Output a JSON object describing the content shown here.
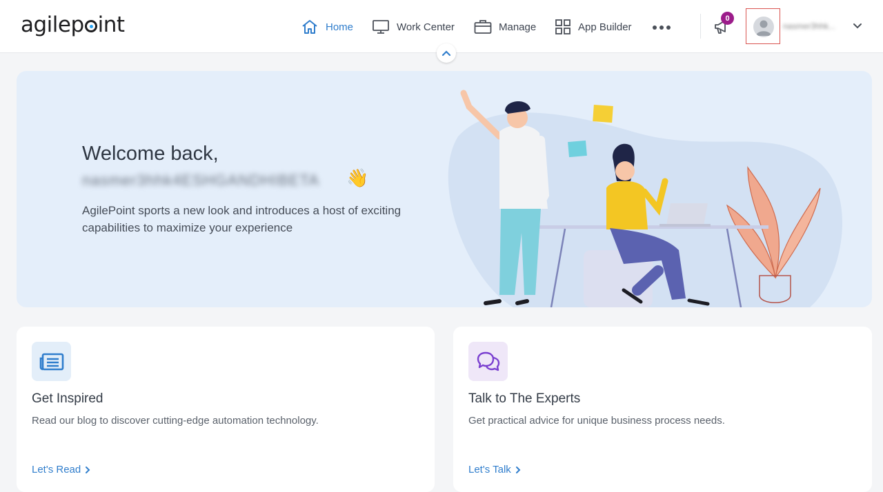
{
  "header": {
    "logo_text": "agilepoint",
    "nav": [
      {
        "label": "Home",
        "icon": "home-icon",
        "active": true
      },
      {
        "label": "Work Center",
        "icon": "monitor-icon"
      },
      {
        "label": "Manage",
        "icon": "briefcase-icon"
      },
      {
        "label": "App Builder",
        "icon": "grid-icon"
      }
    ],
    "more_icon": "more-horizontal-icon",
    "notification_count": "0",
    "user_name": "nasmer3hhk..."
  },
  "hero": {
    "welcome": "Welcome back,",
    "username": "nasmer3hhk4ESHGANDHIBETA",
    "wave_emoji": "👋",
    "intro": "AgilePoint sports a new look and introduces a host of exciting capabilities to maximize your experience"
  },
  "cards": [
    {
      "title": "Get Inspired",
      "description": "Read our blog to discover cutting-edge automation technology.",
      "link": "Let's Read",
      "icon": "newspaper-icon"
    },
    {
      "title": "Talk to The Experts",
      "description": "Get practical advice for unique business process needs.",
      "link": "Let's Talk",
      "icon": "chat-bubbles-icon"
    }
  ],
  "colors": {
    "accent": "#2f7dcc",
    "badge": "#9c1c8a",
    "hero_bg": "#e4eefa",
    "page_bg": "#f4f5f7",
    "highlight_box": "#d9534f"
  }
}
